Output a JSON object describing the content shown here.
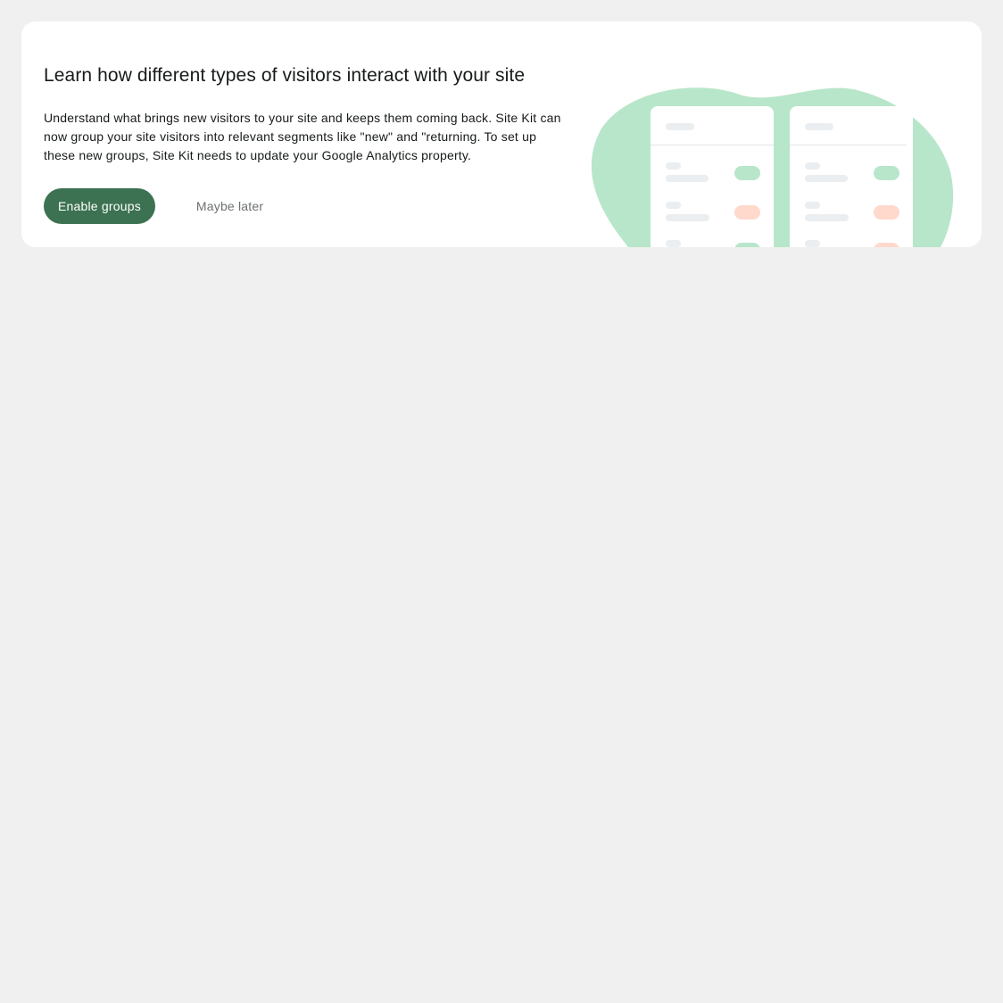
{
  "banner": {
    "title": "Learn how different types of visitors interact with your site",
    "description": "Understand what brings new visitors to your site and keeps them coming back. Site Kit can now group your site visitors into relevant segments like \"new\" and \"returning. To set up these new groups, Site Kit needs to update your Google Analytics property.",
    "primary_button": "Enable groups",
    "secondary_button": "Maybe later"
  },
  "colors": {
    "page_background": "#f0f0f0",
    "card_background": "#ffffff",
    "primary_button": "#3c7251",
    "blob": "#b8e6ca",
    "pill_green": "#b8e6ca",
    "pill_orange": "#fed9cc",
    "placeholder_gray": "#ebeef0"
  },
  "illustration": {
    "name": "visitor-groups-illustration",
    "panels": 2,
    "row_badges": [
      "green",
      "orange",
      "green"
    ]
  }
}
